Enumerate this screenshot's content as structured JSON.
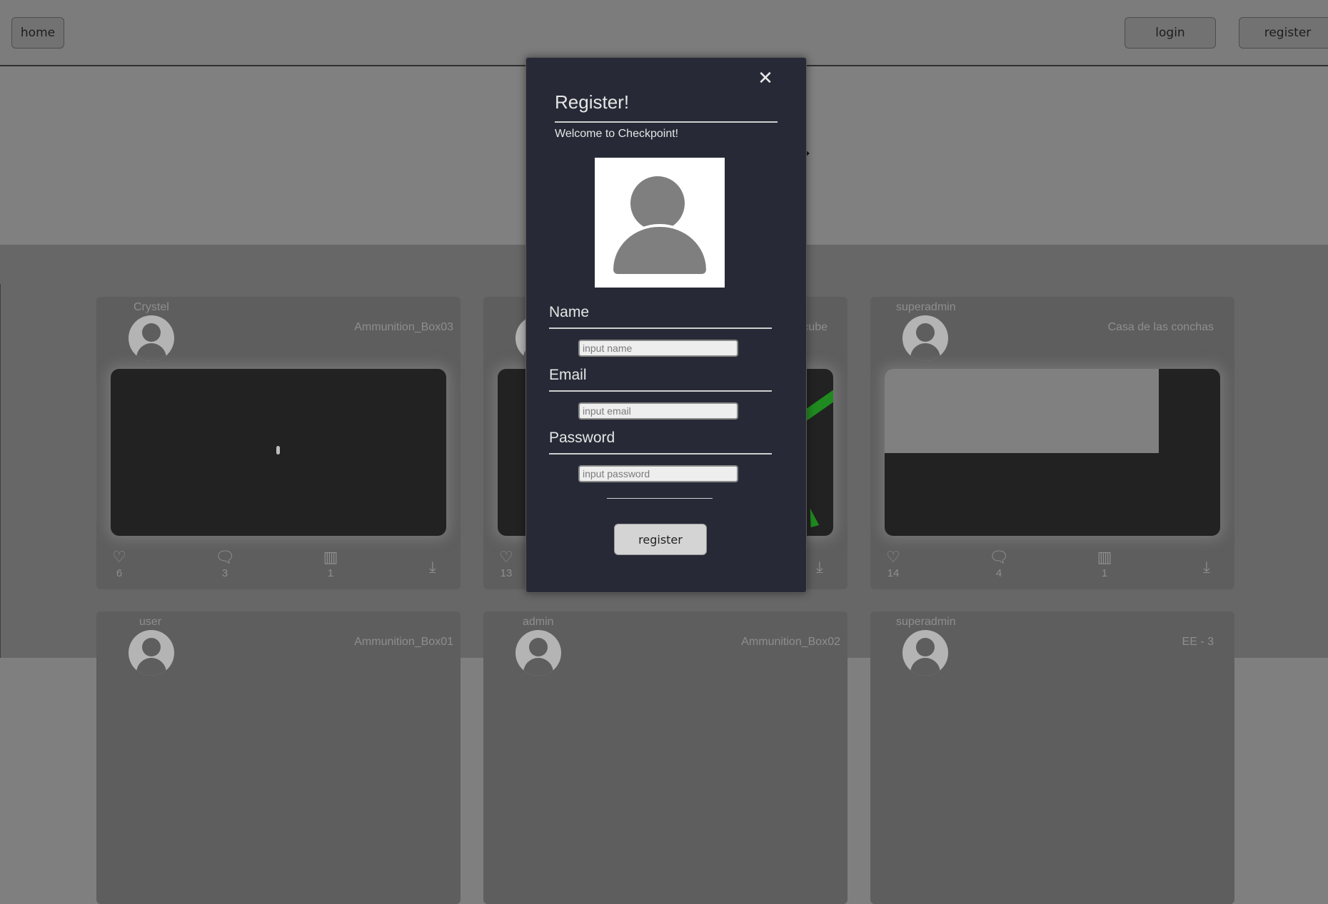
{
  "nav": {
    "home": "home",
    "login": "login",
    "register": "register"
  },
  "cards": [
    {
      "user": "Crystel",
      "model": "Ammunition_Box03",
      "likes": "6",
      "comments": "3",
      "collections": "1"
    },
    {
      "user": "",
      "model": "cube",
      "likes": "13",
      "comments": "",
      "collections": ""
    },
    {
      "user": "superadmin",
      "model": "Casa de las conchas",
      "likes": "14",
      "comments": "4",
      "collections": "1"
    },
    {
      "user": "user",
      "model": "Ammunition_Box01"
    },
    {
      "user": "admin",
      "model": "Ammunition_Box02"
    },
    {
      "user": "superadmin",
      "model": "EE - 3"
    }
  ],
  "modal": {
    "close": "✕",
    "title": "Register!",
    "welcome": "Welcome to Checkpoint!",
    "name_label": "Name",
    "name_placeholder": "input name",
    "email_label": "Email",
    "email_placeholder": "input email",
    "password_label": "Password",
    "password_placeholder": "input password",
    "submit": "register"
  },
  "colors": {
    "modal_bg": "#272a36",
    "overlay_dim": "#7f7f7f",
    "viewer_bg": "#222222",
    "accent_green": "#1f8a1f"
  },
  "icons": [
    "close-icon",
    "avatar-icon",
    "heart-icon",
    "comment-icon",
    "library-icon",
    "download-icon"
  ]
}
